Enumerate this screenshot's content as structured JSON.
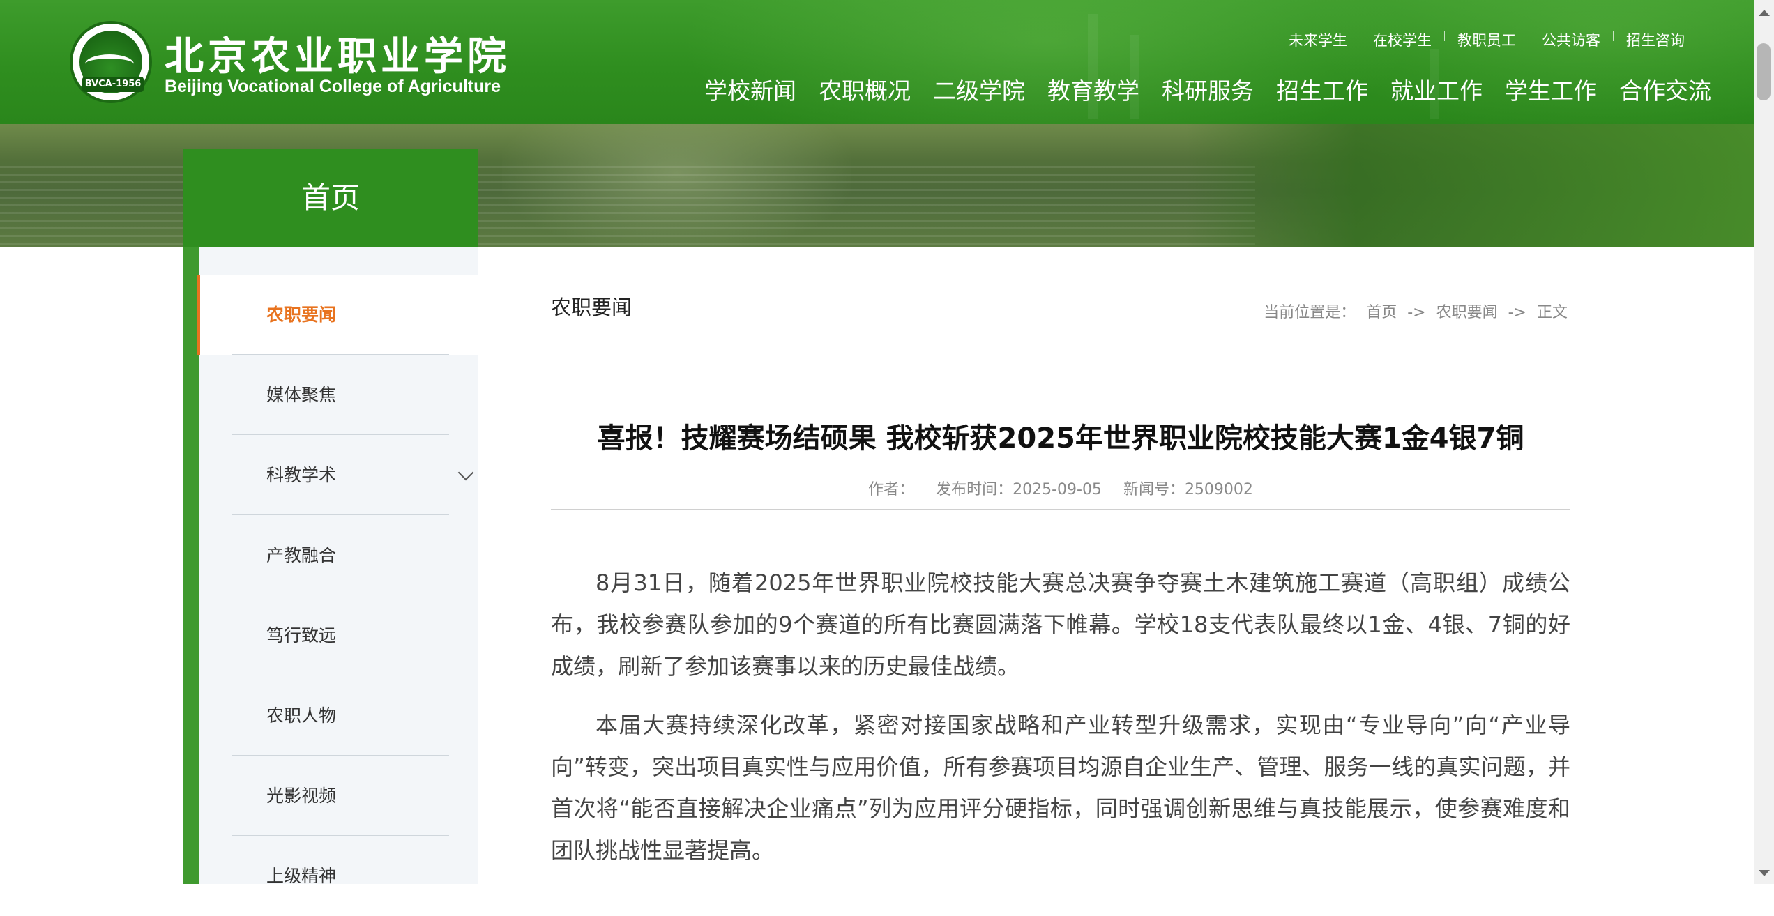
{
  "header": {
    "logo_cn": "北京农业职业学院",
    "logo_en": "Beijing Vocational College of Agriculture",
    "emblem_text": "BVCA-1956",
    "quick_links": [
      "未来学生",
      "在校学生",
      "教职员工",
      "公共访客",
      "招生咨询"
    ],
    "nav": [
      "学校新闻",
      "农职概况",
      "二级学院",
      "教育教学",
      "科研服务",
      "招生工作",
      "就业工作",
      "学生工作",
      "合作交流"
    ]
  },
  "sidebar": {
    "home_label": "首页",
    "items": [
      {
        "label": "农职要闻",
        "active": true
      },
      {
        "label": "媒体聚焦"
      },
      {
        "label": "科教学术",
        "has_children": true
      },
      {
        "label": "产教融合"
      },
      {
        "label": "笃行致远"
      },
      {
        "label": "农职人物"
      },
      {
        "label": "光影视频"
      },
      {
        "label": "上级精神"
      }
    ]
  },
  "content": {
    "section_title": "农职要闻",
    "breadcrumb": {
      "prefix": "当前位置是：",
      "home": "首页",
      "arrow1": "->",
      "section": "农职要闻",
      "arrow2": "->",
      "current": "正文"
    },
    "article": {
      "title": "喜报！技耀赛场结硕果 我校斩获2025年世界职业院校技能大赛1金4银7铜",
      "meta": {
        "author_label": "作者：",
        "publish_label": "发布时间：2025-09-05",
        "news_no_label": "新闻号：2509002"
      },
      "paragraphs": [
        "8月31日，随着2025年世界职业院校技能大赛总决赛争夺赛土木建筑施工赛道（高职组）成绩公布，我校参赛队参加的9个赛道的所有比赛圆满落下帷幕。学校18支代表队最终以1金、4银、7铜的好成绩，刷新了参加该赛事以来的历史最佳战绩。",
        "本届大赛持续深化改革，紧密对接国家战略和产业转型升级需求，实现由“专业导向”向“产业导向”转变，突出项目真实性与应用价值，所有参赛项目均源自企业生产、管理、服务一线的真实问题，并首次将“能否直接解决企业痛点”列为应用评分硬指标，同时强调创新思维与真技能展示，使参赛难度和团队挑战性显著提高。"
      ]
    }
  },
  "colors": {
    "header_green": "#2f8e1f",
    "active_orange": "#e8731f",
    "sidebar_bg": "#f3f6f9"
  }
}
